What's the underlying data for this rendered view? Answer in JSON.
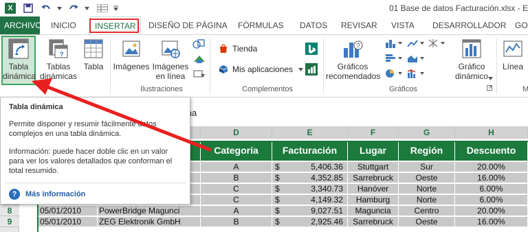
{
  "window": {
    "title": "01 Base de datos Facturación.xlsx - Exce"
  },
  "tabs": [
    {
      "label": "ARCHIVO"
    },
    {
      "label": "INICIO"
    },
    {
      "label": "INSERTAR"
    },
    {
      "label": "DISEÑO DE PÁGINA"
    },
    {
      "label": "FÓRMULAS"
    },
    {
      "label": "DATOS"
    },
    {
      "label": "REVISAR"
    },
    {
      "label": "VISTA"
    },
    {
      "label": "DESARROLLADOR"
    },
    {
      "label": "GO"
    }
  ],
  "ribbon": {
    "tabla_dinamica": {
      "line1": "Tabla",
      "line2": "dinámica"
    },
    "tablas_dinamicas": {
      "line1": "Tablas",
      "line2": "dinámicas"
    },
    "tabla": "Tabla",
    "imagenes": "Imágenes",
    "imagenes_linea": {
      "line1": "Imágenes",
      "line2": "en línea"
    },
    "ilustraciones": "Ilustraciones",
    "tienda": "Tienda",
    "mis_aplicaciones": "Mis aplicaciones",
    "complementos": "Complementos",
    "graficos_recomendados": {
      "line1": "Gráficos",
      "line2": "recomendados"
    },
    "graficos": "Gráficos",
    "grafico_dinamico": {
      "line1": "Gráfico",
      "line2": "dinámico"
    },
    "linea": "Línea",
    "truncated": "M"
  },
  "formula_bar": {
    "text": "echa"
  },
  "tooltip": {
    "title": "Tabla dinámica",
    "p1": "Permite disponer y resumir fácilmente datos complejos en una tabla dinámica.",
    "p2": "Información: puede hacer doble clic en un valor para ver los valores detallados que conforman el total resumido.",
    "more": "Más información"
  },
  "columns": [
    "D",
    "E",
    "F",
    "G",
    "H"
  ],
  "headers": [
    "Categoría",
    "Facturación",
    "Lugar",
    "Región",
    "Descuento"
  ],
  "rows": [
    {
      "num": "",
      "b": "",
      "c": "art",
      "cat": "A",
      "cur": "$",
      "fact": "5,406.36",
      "lugar": "Stuttgart",
      "region": "Sur",
      "desc": "20.00%"
    },
    {
      "num": "",
      "b": "",
      "c": "",
      "cat": "B",
      "cur": "$",
      "fact": "4,352.85",
      "lugar": "Sarrebruck",
      "region": "Oeste",
      "desc": "16.00%"
    },
    {
      "num": "",
      "b": "",
      "c": "ung",
      "cat": "C",
      "cur": "$",
      "fact": "3,340.73",
      "lugar": "Hanóver",
      "region": "Norte",
      "desc": "6.00%"
    },
    {
      "num": "",
      "b": "05/01/2010",
      "c": "MGO Hamburg",
      "cat": "C",
      "cur": "$",
      "fact": "4,149.32",
      "lugar": "Hamburg",
      "region": "Norte",
      "desc": "6.00%"
    },
    {
      "num": "8",
      "b": "05/01/2010",
      "c": "PowerBridge Magunci",
      "cat": "A",
      "cur": "$",
      "fact": "9,027.51",
      "lugar": "Maguncia",
      "region": "Centro",
      "desc": "20.00%"
    },
    {
      "num": "9",
      "b": "05/01/2010",
      "c": "ZEG Elektronik GmbH",
      "cat": "B",
      "cur": "$",
      "fact": "2,925.46",
      "lugar": "Sarrebruck",
      "region": "Oeste",
      "desc": "16.00%"
    }
  ],
  "colors": {
    "excel_green": "#217346",
    "header_green": "#1c7a3c",
    "highlight_red": "#e62a2a",
    "arrow_red": "#e8201f",
    "cell_gray": "#c8c8c8"
  }
}
